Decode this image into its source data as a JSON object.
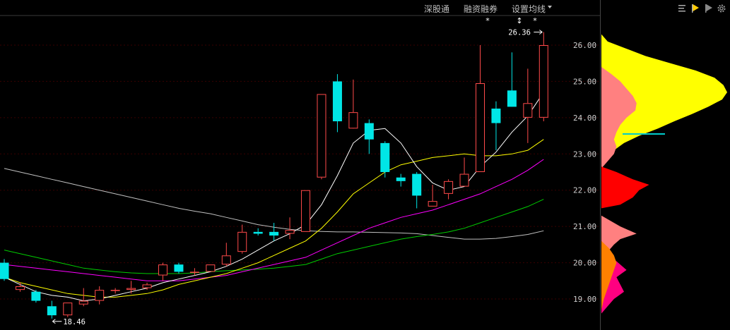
{
  "toolbar": {
    "links": [
      "深股通",
      "融资融券",
      "设置均线"
    ],
    "dropdown_icon": "chevron-down-icon",
    "right_icons": [
      "lines-icon",
      "flag-yellow-icon",
      "flag-gray-icon",
      "gear-icon"
    ]
  },
  "colors": {
    "up": "#ff4a4a",
    "down": "#00e6e6",
    "ma5": "#ffffff",
    "ma10": "#ffff00",
    "ma20": "#ff00ff",
    "ma30": "#00cc00",
    "ma60": "#c0c0c0",
    "profile_yellow": "#ffff00",
    "profile_pink": "#ff8080",
    "profile_red": "#ff0000",
    "profile_magenta": "#ff0080",
    "profile_orange": "#ff8000",
    "cost_line": "#00cccc"
  },
  "chart_data": {
    "type": "candlestick",
    "ylim": [
      18.6,
      26.7
    ],
    "yticks": [
      "19.00",
      "20.00",
      "21.00",
      "22.00",
      "23.00",
      "24.00",
      "25.00",
      "26.00"
    ],
    "annotations": {
      "high": "26.36",
      "low": "18.46"
    },
    "markers": [
      "*",
      "↕",
      "*"
    ],
    "candles": [
      {
        "o": 20.0,
        "h": 20.1,
        "c": 19.55,
        "l": 19.5
      },
      {
        "o": 19.25,
        "h": 19.45,
        "c": 19.35,
        "l": 19.2
      },
      {
        "o": 19.2,
        "h": 19.25,
        "c": 18.95,
        "l": 18.9
      },
      {
        "o": 18.8,
        "h": 18.95,
        "c": 18.55,
        "l": 18.46
      },
      {
        "o": 18.55,
        "h": 18.9,
        "c": 18.9,
        "l": 18.5
      },
      {
        "o": 18.85,
        "h": 19.3,
        "c": 18.95,
        "l": 18.8
      },
      {
        "o": 18.95,
        "h": 19.35,
        "c": 19.25,
        "l": 18.85
      },
      {
        "o": 19.25,
        "h": 19.3,
        "c": 19.25,
        "l": 19.15
      },
      {
        "o": 19.25,
        "h": 19.5,
        "c": 19.3,
        "l": 19.15
      },
      {
        "o": 19.3,
        "h": 19.45,
        "c": 19.4,
        "l": 19.25
      },
      {
        "o": 19.65,
        "h": 20.0,
        "c": 19.95,
        "l": 19.5
      },
      {
        "o": 19.95,
        "h": 20.0,
        "c": 19.75,
        "l": 19.7
      },
      {
        "o": 19.75,
        "h": 19.85,
        "c": 19.75,
        "l": 19.65
      },
      {
        "o": 19.75,
        "h": 19.95,
        "c": 19.95,
        "l": 19.75
      },
      {
        "o": 19.95,
        "h": 20.55,
        "c": 20.2,
        "l": 19.9
      },
      {
        "o": 20.3,
        "h": 21.05,
        "c": 20.85,
        "l": 20.25
      },
      {
        "o": 20.85,
        "h": 20.95,
        "c": 20.8,
        "l": 20.75
      },
      {
        "o": 20.85,
        "h": 21.1,
        "c": 20.75,
        "l": 20.6
      },
      {
        "o": 20.8,
        "h": 21.25,
        "c": 20.9,
        "l": 20.65
      },
      {
        "o": 20.85,
        "h": 22.0,
        "c": 22.0,
        "l": 20.85
      },
      {
        "o": 22.35,
        "h": 24.65,
        "c": 24.65,
        "l": 22.3
      },
      {
        "o": 25.0,
        "h": 25.2,
        "c": 23.9,
        "l": 23.6
      },
      {
        "o": 23.7,
        "h": 25.05,
        "c": 24.15,
        "l": 23.75
      },
      {
        "o": 23.85,
        "h": 23.95,
        "c": 23.4,
        "l": 23.0
      },
      {
        "o": 23.3,
        "h": 23.35,
        "c": 22.5,
        "l": 22.35
      },
      {
        "o": 22.35,
        "h": 22.45,
        "c": 22.25,
        "l": 22.1
      },
      {
        "o": 22.45,
        "h": 22.5,
        "c": 21.85,
        "l": 21.5
      },
      {
        "o": 21.55,
        "h": 22.15,
        "c": 21.7,
        "l": 21.55
      },
      {
        "o": 21.9,
        "h": 22.3,
        "c": 22.25,
        "l": 21.75
      },
      {
        "o": 22.1,
        "h": 22.9,
        "c": 22.45,
        "l": 22.1
      },
      {
        "o": 22.5,
        "h": 26.0,
        "c": 24.95,
        "l": 22.5
      },
      {
        "o": 24.25,
        "h": 24.45,
        "c": 23.85,
        "l": 23.1
      },
      {
        "o": 24.75,
        "h": 25.8,
        "c": 24.3,
        "l": 24.3
      },
      {
        "o": 24.0,
        "h": 25.35,
        "c": 24.4,
        "l": 23.3
      },
      {
        "o": 24.0,
        "h": 26.36,
        "c": 26.0,
        "l": 23.9
      }
    ],
    "ma5": [
      19.6,
      19.4,
      19.2,
      19.1,
      19.05,
      18.95,
      19.0,
      19.1,
      19.2,
      19.3,
      19.45,
      19.55,
      19.65,
      19.75,
      19.9,
      20.1,
      20.35,
      20.6,
      20.8,
      21.05,
      21.6,
      22.4,
      23.3,
      23.65,
      23.7,
      23.3,
      22.65,
      22.2,
      22.0,
      22.1,
      22.65,
      23.05,
      23.6,
      24.05,
      24.7
    ],
    "ma10": [
      19.6,
      19.45,
      19.35,
      19.25,
      19.15,
      19.1,
      19.05,
      19.05,
      19.1,
      19.15,
      19.25,
      19.4,
      19.5,
      19.6,
      19.7,
      19.85,
      20.0,
      20.2,
      20.4,
      20.6,
      20.95,
      21.4,
      21.9,
      22.2,
      22.5,
      22.7,
      22.8,
      22.9,
      22.95,
      23.0,
      22.95,
      22.95,
      23.0,
      23.1,
      23.4
    ],
    "ma20": [
      19.95,
      19.9,
      19.85,
      19.8,
      19.75,
      19.7,
      19.65,
      19.6,
      19.55,
      19.5,
      19.5,
      19.5,
      19.55,
      19.6,
      19.65,
      19.75,
      19.85,
      19.95,
      20.05,
      20.15,
      20.35,
      20.55,
      20.75,
      20.95,
      21.1,
      21.25,
      21.35,
      21.45,
      21.6,
      21.75,
      21.9,
      22.1,
      22.3,
      22.55,
      22.85
    ],
    "ma30": [
      20.35,
      20.25,
      20.15,
      20.05,
      19.95,
      19.85,
      19.8,
      19.75,
      19.72,
      19.7,
      19.7,
      19.7,
      19.72,
      19.75,
      19.78,
      19.8,
      19.82,
      19.85,
      19.9,
      19.95,
      20.1,
      20.25,
      20.35,
      20.45,
      20.55,
      20.65,
      20.72,
      20.78,
      20.85,
      20.95,
      21.1,
      21.25,
      21.4,
      21.55,
      21.75
    ],
    "ma60": [
      22.6,
      22.5,
      22.4,
      22.3,
      22.2,
      22.1,
      22.0,
      21.9,
      21.8,
      21.7,
      21.6,
      21.5,
      21.42,
      21.35,
      21.25,
      21.15,
      21.05,
      20.98,
      20.92,
      20.88,
      20.86,
      20.85,
      20.85,
      20.84,
      20.83,
      20.82,
      20.8,
      20.75,
      20.7,
      20.65,
      20.65,
      20.67,
      20.72,
      20.78,
      20.88
    ]
  },
  "profile": {
    "cost_price": 23.55,
    "yellow": [
      [
        26.3,
        0.0
      ],
      [
        26.1,
        0.05
      ],
      [
        25.9,
        0.2
      ],
      [
        25.7,
        0.35
      ],
      [
        25.5,
        0.55
      ],
      [
        25.3,
        0.75
      ],
      [
        25.1,
        0.9
      ],
      [
        24.9,
        0.97
      ],
      [
        24.7,
        1.0
      ],
      [
        24.5,
        0.96
      ],
      [
        24.3,
        0.85
      ],
      [
        24.1,
        0.72
      ],
      [
        23.9,
        0.58
      ],
      [
        23.7,
        0.45
      ],
      [
        23.5,
        0.3
      ],
      [
        23.3,
        0.18
      ],
      [
        23.1,
        0.1
      ],
      [
        22.9,
        0.04
      ],
      [
        22.7,
        0.0
      ]
    ],
    "pink_upper": [
      [
        25.4,
        0.0
      ],
      [
        25.2,
        0.08
      ],
      [
        25.0,
        0.15
      ],
      [
        24.8,
        0.2
      ],
      [
        24.6,
        0.25
      ],
      [
        24.4,
        0.28
      ],
      [
        24.2,
        0.27
      ],
      [
        24.0,
        0.2
      ],
      [
        23.8,
        0.15
      ],
      [
        23.6,
        0.12
      ],
      [
        23.4,
        0.1
      ],
      [
        23.2,
        0.12
      ],
      [
        23.0,
        0.1
      ],
      [
        22.8,
        0.05
      ],
      [
        22.6,
        0.0
      ]
    ],
    "red": [
      [
        22.65,
        0.0
      ],
      [
        22.5,
        0.12
      ],
      [
        22.3,
        0.25
      ],
      [
        22.15,
        0.38
      ],
      [
        22.0,
        0.3
      ],
      [
        21.8,
        0.25
      ],
      [
        21.6,
        0.15
      ],
      [
        21.5,
        0.0
      ]
    ],
    "pink_lower": [
      [
        21.3,
        0.0
      ],
      [
        21.2,
        0.05
      ],
      [
        21.0,
        0.15
      ],
      [
        20.8,
        0.28
      ],
      [
        20.65,
        0.15
      ],
      [
        20.5,
        0.1
      ],
      [
        20.3,
        0.05
      ],
      [
        20.1,
        0.0
      ]
    ],
    "magenta": [
      [
        20.3,
        0.0
      ],
      [
        20.1,
        0.1
      ],
      [
        19.95,
        0.15
      ],
      [
        19.8,
        0.2
      ],
      [
        19.6,
        0.12
      ],
      [
        19.4,
        0.15
      ],
      [
        19.2,
        0.18
      ],
      [
        19.0,
        0.1
      ],
      [
        18.8,
        0.05
      ],
      [
        18.6,
        0.0
      ]
    ],
    "orange": [
      [
        20.6,
        0.0
      ],
      [
        20.4,
        0.06
      ],
      [
        20.2,
        0.1
      ],
      [
        20.0,
        0.12
      ],
      [
        19.8,
        0.1
      ],
      [
        19.6,
        0.08
      ],
      [
        19.4,
        0.06
      ],
      [
        19.2,
        0.04
      ],
      [
        19.0,
        0.02
      ],
      [
        18.7,
        0.0
      ]
    ]
  }
}
